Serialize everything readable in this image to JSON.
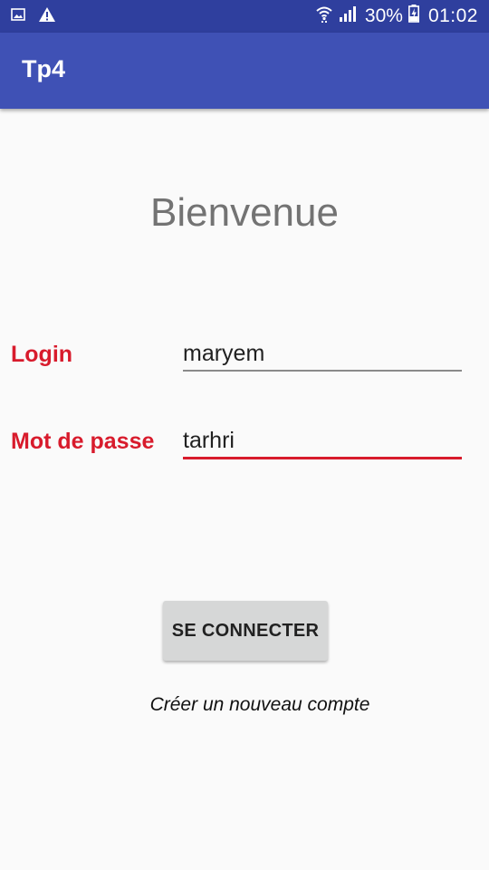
{
  "status_bar": {
    "battery_percent": "30%",
    "time": "01:02",
    "icons": [
      "image-notification-icon",
      "warning-icon",
      "wifi-icon",
      "signal-icon",
      "battery-charging-icon"
    ],
    "background": "#2f3f9e"
  },
  "app_bar": {
    "title": "Tp4",
    "background": "#3f51b5"
  },
  "main": {
    "welcome": "Bienvenue",
    "login_label": "Login",
    "login_value": "maryem",
    "password_label": "Mot de passe",
    "password_value": "tarhri",
    "connect_button": "SE CONNECTER",
    "create_account_link": "Créer un nouveau compte",
    "accent_color": "#d81b2c"
  }
}
